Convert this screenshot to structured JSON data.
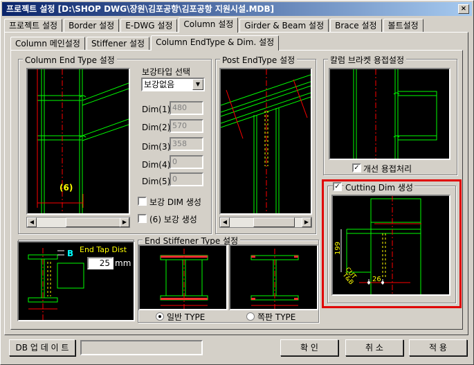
{
  "window": {
    "title": "프로젝트 설정  [D:\\SHOP DWG\\장원\\김포공항\\김포공항 지원시설.MDB]",
    "close": "×"
  },
  "main_tabs": [
    "프로젝트 설정",
    "Border 설정",
    "E-DWG 설정",
    "Column 설정",
    "Girder & Beam 설정",
    "Brace 설정",
    "볼트설정"
  ],
  "sub_tabs": [
    "Column 메인설정",
    "Stiffener 설정",
    "Column EndType & Dim. 설정"
  ],
  "column_end": {
    "group_label": "Column End Type 설정",
    "marker": "(6)",
    "reinforce_label": "보강타입 선택",
    "reinforce_value": "보강없음",
    "dims": [
      {
        "label": "Dim(1)",
        "value": "480"
      },
      {
        "label": "Dim(2)",
        "value": "570"
      },
      {
        "label": "Dim(3)",
        "value": "358"
      },
      {
        "label": "Dim(4)",
        "value": "0"
      },
      {
        "label": "Dim(5)",
        "value": "0"
      }
    ],
    "chk_dim": "보강 DIM 생성",
    "chk_6": "(6) 보강 생성"
  },
  "post_end": {
    "group_label": "Post EndType 설정"
  },
  "bracket": {
    "group_label": "칼럼 브라켓 용접설정",
    "chk_label": "개선 용접처리",
    "chk_checked": true
  },
  "cutting": {
    "chk_label": "Cutting Dim 생성",
    "chk_checked": true,
    "dim_199": "199",
    "dim_cut": "CUT",
    "dim_t": "T&B",
    "dim_26": "26"
  },
  "tap": {
    "b_label": "B",
    "title": "End Tap Dist",
    "value": "25",
    "unit": "mm"
  },
  "end_stiffener": {
    "group_label": "End Stiffener Type 설정",
    "opt1": "일반 TYPE",
    "opt2": "쪽판 TYPE",
    "selected": "일반 TYPE"
  },
  "bottom": {
    "db_update": "DB 업 데 이 트",
    "ok": "확   인",
    "cancel": "취   소",
    "apply": "적   용"
  }
}
